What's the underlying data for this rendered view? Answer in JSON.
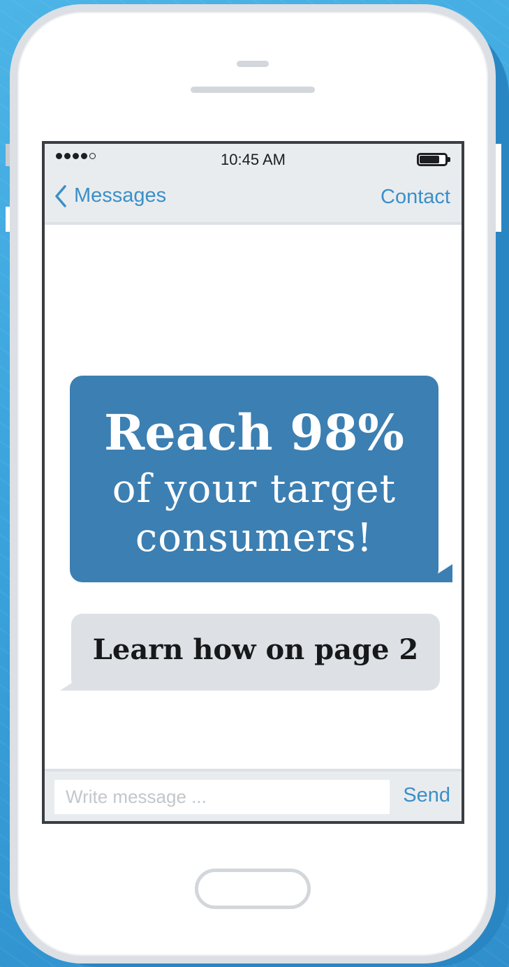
{
  "statusbar": {
    "time": "10:45 AM",
    "signal_dots": [
      true,
      true,
      true,
      true,
      false
    ]
  },
  "navbar": {
    "back_label": "Messages",
    "back_icon": "chevron-left-icon",
    "contact_label": "Contact"
  },
  "messages": {
    "outgoing": {
      "line1": "Reach 98%",
      "line2": "of your target",
      "line3": "consumers!"
    },
    "incoming": {
      "text": "Learn how on page 2"
    }
  },
  "composer": {
    "placeholder": "Write message ...",
    "value": "",
    "send_label": "Send"
  },
  "colors": {
    "accent": "#3b8fc7",
    "outgoing_bubble": "#3c7fb2",
    "incoming_bubble": "#dde0e4",
    "background": "#3aa3dc"
  }
}
